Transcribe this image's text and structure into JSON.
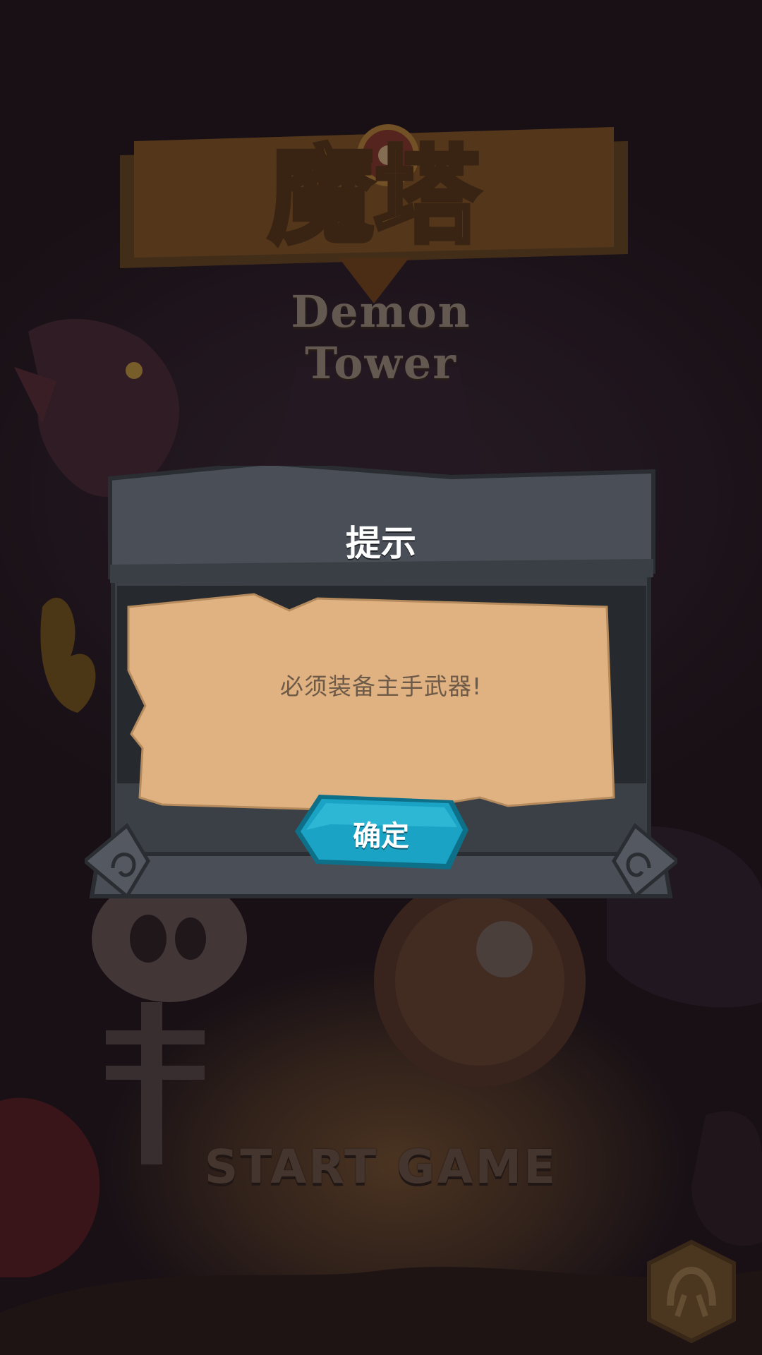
{
  "game": {
    "logo_cn": "魔塔",
    "logo_en": "Demon Tower",
    "start_label": "START GAME"
  },
  "dialog": {
    "title": "提示",
    "message": "必须装备主手武器!",
    "confirm_label": "确定"
  },
  "colors": {
    "dialog_frame": "#4a4f57",
    "parchment": "#e0b282",
    "confirm_button": "#1aa3c4"
  },
  "icons": {
    "corner_button": "demon-horns-icon"
  }
}
